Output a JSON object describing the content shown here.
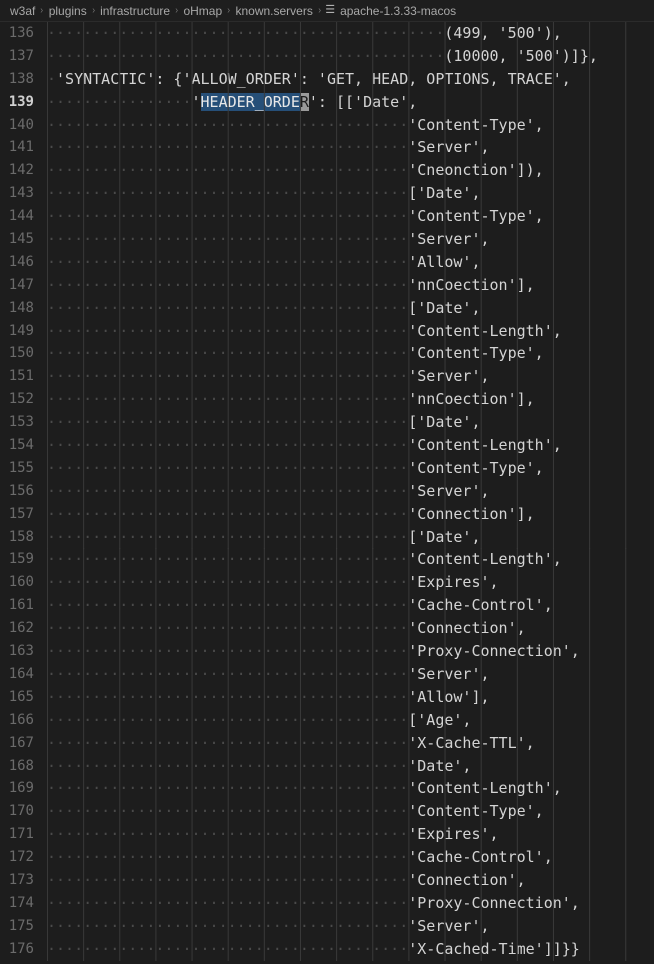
{
  "window": {
    "background_color": "#1d1d1d",
    "foreground_color": "#d4d4d4"
  },
  "breadcrumb": {
    "separator": "›",
    "items": [
      {
        "label": "w3af",
        "kind": "folder"
      },
      {
        "label": "plugins",
        "kind": "folder"
      },
      {
        "label": "infrastructure",
        "kind": "folder"
      },
      {
        "label": "oHmap",
        "kind": "folder"
      },
      {
        "label": "known.servers",
        "kind": "folder"
      },
      {
        "label": "apache-1.3.33-macos",
        "kind": "symbol",
        "icon": "list-symbol-icon",
        "icon_glyph": "☰"
      }
    ]
  },
  "editor": {
    "active_line": 139,
    "selection": {
      "line": 139,
      "selected_text": "HEADER_ORDE",
      "cursor_char": "R",
      "selection_color": "#264f78",
      "cursor_color": "#9a9a9a"
    },
    "whitespace_dot": "·",
    "first_line": 136,
    "last_line": 176,
    "lines": [
      {
        "n": 136,
        "indent": 44,
        "text": "(499, '500'),"
      },
      {
        "n": 137,
        "indent": 44,
        "text": "(10000, '500')]},"
      },
      {
        "n": 138,
        "indent": 1,
        "text": "'SYNTACTIC': {'ALLOW_ORDER': 'GET, HEAD, OPTIONS, TRACE',"
      },
      {
        "n": 139,
        "indent": 16,
        "text": "'HEADER_ORDER': [['Date',",
        "sel_start": 17,
        "sel_len": 11,
        "cursor_at": 28
      },
      {
        "n": 140,
        "indent": 40,
        "text": "'Content-Type',"
      },
      {
        "n": 141,
        "indent": 40,
        "text": "'Server',"
      },
      {
        "n": 142,
        "indent": 40,
        "text": "'Cneonction']),"
      },
      {
        "n": 143,
        "indent": 40,
        "text": "['Date',"
      },
      {
        "n": 144,
        "indent": 40,
        "text": "'Content-Type',"
      },
      {
        "n": 145,
        "indent": 40,
        "text": "'Server',"
      },
      {
        "n": 146,
        "indent": 40,
        "text": "'Allow',"
      },
      {
        "n": 147,
        "indent": 40,
        "text": "'nnCoection'],"
      },
      {
        "n": 148,
        "indent": 40,
        "text": "['Date',"
      },
      {
        "n": 149,
        "indent": 40,
        "text": "'Content-Length',"
      },
      {
        "n": 150,
        "indent": 40,
        "text": "'Content-Type',"
      },
      {
        "n": 151,
        "indent": 40,
        "text": "'Server',"
      },
      {
        "n": 152,
        "indent": 40,
        "text": "'nnCoection'],"
      },
      {
        "n": 153,
        "indent": 40,
        "text": "['Date',"
      },
      {
        "n": 154,
        "indent": 40,
        "text": "'Content-Length',"
      },
      {
        "n": 155,
        "indent": 40,
        "text": "'Content-Type',"
      },
      {
        "n": 156,
        "indent": 40,
        "text": "'Server',"
      },
      {
        "n": 157,
        "indent": 40,
        "text": "'Connection'],"
      },
      {
        "n": 158,
        "indent": 40,
        "text": "['Date',"
      },
      {
        "n": 159,
        "indent": 40,
        "text": "'Content-Length',"
      },
      {
        "n": 160,
        "indent": 40,
        "text": "'Expires',"
      },
      {
        "n": 161,
        "indent": 40,
        "text": "'Cache-Control',"
      },
      {
        "n": 162,
        "indent": 40,
        "text": "'Connection',"
      },
      {
        "n": 163,
        "indent": 40,
        "text": "'Proxy-Connection',"
      },
      {
        "n": 164,
        "indent": 40,
        "text": "'Server',"
      },
      {
        "n": 165,
        "indent": 40,
        "text": "'Allow'],"
      },
      {
        "n": 166,
        "indent": 40,
        "text": "['Age',"
      },
      {
        "n": 167,
        "indent": 40,
        "text": "'X-Cache-TTL',"
      },
      {
        "n": 168,
        "indent": 40,
        "text": "'Date',"
      },
      {
        "n": 169,
        "indent": 40,
        "text": "'Content-Length',"
      },
      {
        "n": 170,
        "indent": 40,
        "text": "'Content-Type',"
      },
      {
        "n": 171,
        "indent": 40,
        "text": "'Expires',"
      },
      {
        "n": 172,
        "indent": 40,
        "text": "'Cache-Control',"
      },
      {
        "n": 173,
        "indent": 40,
        "text": "'Connection',"
      },
      {
        "n": 174,
        "indent": 40,
        "text": "'Proxy-Connection',"
      },
      {
        "n": 175,
        "indent": 40,
        "text": "'Server',"
      },
      {
        "n": 176,
        "indent": 40,
        "text": "'X-Cached-Time']]}}"
      }
    ]
  }
}
